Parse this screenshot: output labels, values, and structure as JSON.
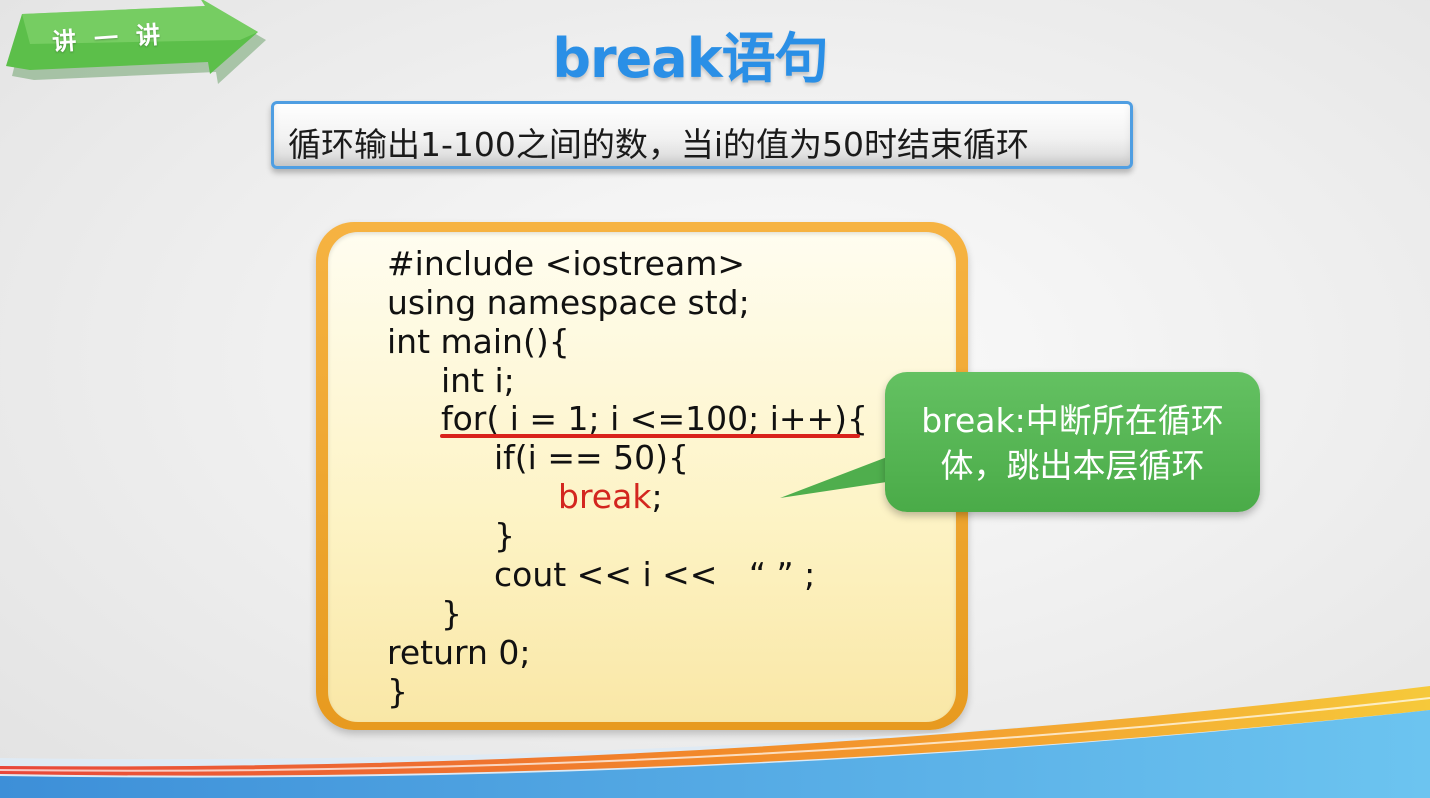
{
  "tag": {
    "label": "讲一讲",
    "color": "#5cbf4a"
  },
  "title": "break语句",
  "subtitle": "循环输出1-100之间的数，当i的值为50时结束循环",
  "code": {
    "lines": [
      "#include <iostream>",
      "using namespace std;",
      "int main(){",
      "int i;",
      "for( i = 1; i <=100; i++){",
      "if(i == 50){",
      "break",
      ";",
      "}",
      "cout << i <<   “ ” ;",
      "}",
      "return 0;",
      "}"
    ],
    "highlight_keyword": "break",
    "highlight_color": "#d3261f"
  },
  "callout": {
    "line1": "break:中断所在循环",
    "line2": "体，跳出本层循环",
    "color": "#55b553"
  },
  "colors": {
    "title": "#2a8fe6",
    "subtitle_border": "#4f9ee2",
    "code_border": "#eca52e"
  }
}
